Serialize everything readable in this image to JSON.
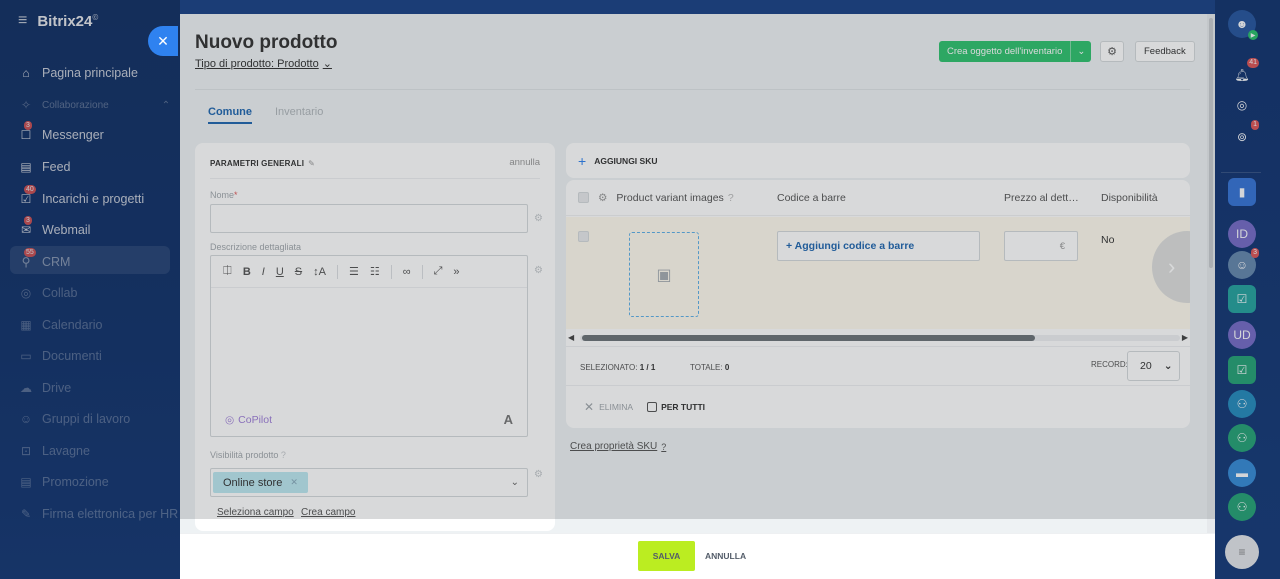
{
  "brand": {
    "name": "Bitrix24",
    "suffix": "©"
  },
  "left_nav": {
    "items": [
      {
        "label": "Pagina principale",
        "icon": "home-icon",
        "badge": ""
      },
      {
        "label": "Collaborazione",
        "icon": "collab-icon",
        "badge": ""
      },
      {
        "label": "Messenger",
        "icon": "chat-icon",
        "badge": "3"
      },
      {
        "label": "Feed",
        "icon": "feed-icon",
        "badge": ""
      },
      {
        "label": "Incarichi e progetti",
        "icon": "tasks-icon",
        "badge": "40"
      },
      {
        "label": "Webmail",
        "icon": "mail-icon",
        "badge": "3"
      },
      {
        "label": "CRM",
        "icon": "crm-icon",
        "badge": "55"
      },
      {
        "label": "Collab",
        "icon": "collab2-icon",
        "badge": ""
      },
      {
        "label": "Calendario",
        "icon": "calendar-icon",
        "badge": ""
      },
      {
        "label": "Documenti",
        "icon": "documents-icon",
        "badge": ""
      },
      {
        "label": "Drive",
        "icon": "drive-icon",
        "badge": ""
      },
      {
        "label": "Gruppi di lavoro",
        "icon": "groups-icon",
        "badge": ""
      },
      {
        "label": "Lavagne",
        "icon": "boards-icon",
        "badge": ""
      },
      {
        "label": "Promozione",
        "icon": "promo-icon",
        "badge": ""
      },
      {
        "label": "Firma elettronica per HR",
        "icon": "signature-icon",
        "badge": ""
      }
    ]
  },
  "right_sidebar": {
    "notifications_badge": "41",
    "chat_badge": "1",
    "avatar_badge": "3"
  },
  "page": {
    "title": "Nuovo prodotto",
    "product_type": "Tipo di prodotto: Prodotto",
    "create_inventory_button": "Crea oggetto dell'inventario",
    "feedback_button": "Feedback",
    "tabs": [
      "Comune",
      "Inventario"
    ]
  },
  "params": {
    "title": "PARAMETRI GENERALI",
    "cancel": "annulla",
    "name_label": "Nome",
    "name_required": "*",
    "name_value": "",
    "description_label": "Descrizione dettagliata",
    "copilot_label": "CoPilot",
    "visibility_label": "Visibilità prodotto",
    "visibility_tag": "Online store",
    "select_field_link": "Seleziona campo",
    "create_field_link": "Crea campo"
  },
  "sku": {
    "add_sku": "AGGIUNGI SKU",
    "columns": [
      "Product variant images",
      "Codice a barre",
      "Prezzo al dett…",
      "Disponibilità"
    ],
    "add_barcode": "+ Aggiungi codice a barre",
    "currency": "€",
    "availability_value": "No",
    "selected_label": "SELEZIONATO:",
    "selected_value": "1 / 1",
    "total_label": "TOTALE:",
    "total_value": "0",
    "record_label": "RECORD:",
    "record_value": "20",
    "delete_label": "ELIMINA",
    "for_all_label": "PER TUTTI",
    "props_link": "Crea proprietà SKU"
  },
  "bottom": {
    "save": "SALVA",
    "cancel": "ANNULLA"
  },
  "colors": {
    "primary": "#2067b0",
    "accent_green": "#2fc26e",
    "save_lime": "#bbed21",
    "sidebar_bg": "#17376b"
  }
}
